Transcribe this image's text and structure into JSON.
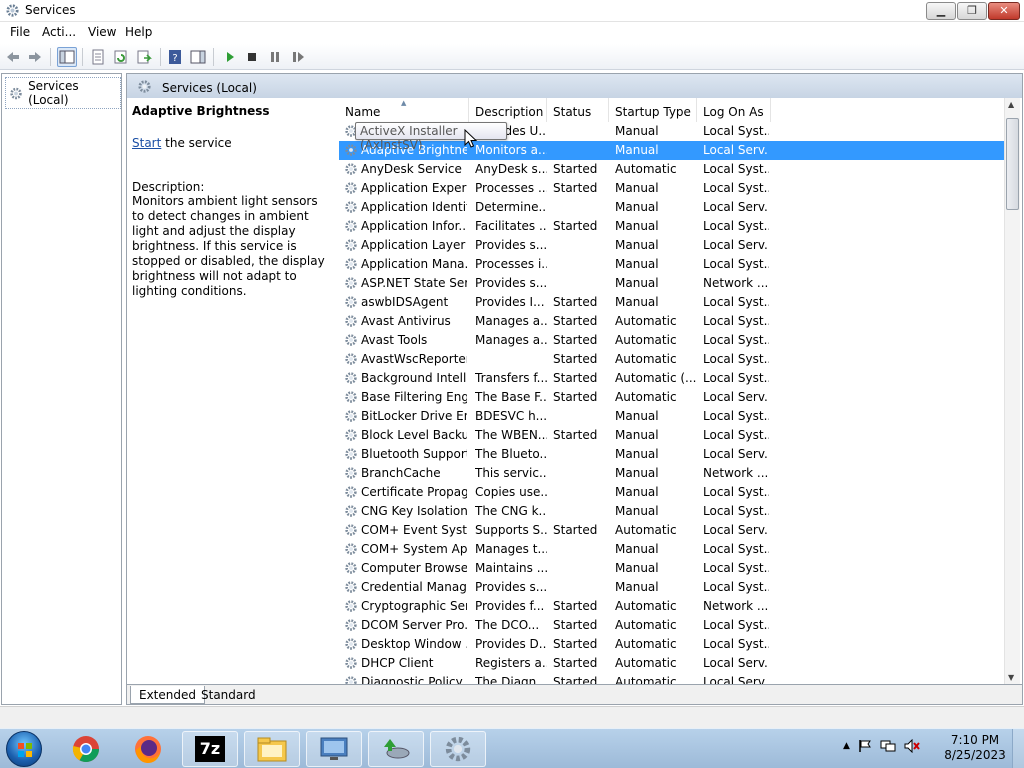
{
  "window": {
    "title": "Services",
    "buttons": {
      "minimize": "▁",
      "maximize": "❐",
      "close": "✕"
    }
  },
  "menu": [
    "File",
    "Acti...",
    "View",
    "Help"
  ],
  "toolbar": {
    "icons": [
      "back-icon",
      "forward-icon",
      "show-hide-console-tree-icon",
      "properties-icon",
      "refresh-icon",
      "export-list-icon",
      "help-icon",
      "show-action-pane-icon",
      "start-service-icon",
      "stop-service-icon",
      "pause-service-icon",
      "restart-service-icon"
    ]
  },
  "tree": {
    "root_label": "Services (Local)"
  },
  "main": {
    "header_title": "Services (Local)",
    "selected_service": "Adaptive Brightness",
    "start_link": "Start",
    "start_suffix": " the service",
    "description_label": "Description:",
    "description_text": "Monitors ambient light sensors to detect changes in ambient light and adjust the display brightness.  If this service is stopped or disabled, the display brightness will not adapt to lighting conditions."
  },
  "columns": [
    "Name",
    "Description",
    "Status",
    "Startup Type",
    "Log On As"
  ],
  "tooltip": "ActiveX Installer (AxInstSV)",
  "rows": [
    {
      "name": "ActiveX Installer (AxInstSV)",
      "description": "Provides U...",
      "status": "",
      "startup": "Manual",
      "logon": "Local Syst..."
    },
    {
      "name": "Adaptive Brightness",
      "description": "Monitors a...",
      "status": "",
      "startup": "Manual",
      "logon": "Local Serv..."
    },
    {
      "name": "AnyDesk Service",
      "description": "AnyDesk s...",
      "status": "Started",
      "startup": "Automatic",
      "logon": "Local Syst..."
    },
    {
      "name": "Application Experi...",
      "description": "Processes ...",
      "status": "Started",
      "startup": "Manual",
      "logon": "Local Syst..."
    },
    {
      "name": "Application Identity",
      "description": "Determine...",
      "status": "",
      "startup": "Manual",
      "logon": "Local Serv..."
    },
    {
      "name": "Application Infor...",
      "description": "Facilitates ...",
      "status": "Started",
      "startup": "Manual",
      "logon": "Local Syst..."
    },
    {
      "name": "Application Layer ...",
      "description": "Provides s...",
      "status": "",
      "startup": "Manual",
      "logon": "Local Serv..."
    },
    {
      "name": "Application Mana...",
      "description": "Processes i...",
      "status": "",
      "startup": "Manual",
      "logon": "Local Syst..."
    },
    {
      "name": "ASP.NET State Ser...",
      "description": "Provides s...",
      "status": "",
      "startup": "Manual",
      "logon": "Network ..."
    },
    {
      "name": "aswbIDSAgent",
      "description": "Provides I...",
      "status": "Started",
      "startup": "Manual",
      "logon": "Local Syst..."
    },
    {
      "name": "Avast Antivirus",
      "description": "Manages a...",
      "status": "Started",
      "startup": "Automatic",
      "logon": "Local Syst..."
    },
    {
      "name": "Avast Tools",
      "description": "Manages a...",
      "status": "Started",
      "startup": "Automatic",
      "logon": "Local Syst..."
    },
    {
      "name": "AvastWscReporter",
      "description": "",
      "status": "Started",
      "startup": "Automatic",
      "logon": "Local Syst..."
    },
    {
      "name": "Background Intelli...",
      "description": "Transfers f...",
      "status": "Started",
      "startup": "Automatic (...",
      "logon": "Local Syst..."
    },
    {
      "name": "Base Filtering Engi...",
      "description": "The Base F...",
      "status": "Started",
      "startup": "Automatic",
      "logon": "Local Serv..."
    },
    {
      "name": "BitLocker Drive En...",
      "description": "BDESVC h...",
      "status": "",
      "startup": "Manual",
      "logon": "Local Syst..."
    },
    {
      "name": "Block Level Backu...",
      "description": "The WBEN...",
      "status": "Started",
      "startup": "Manual",
      "logon": "Local Syst..."
    },
    {
      "name": "Bluetooth Support...",
      "description": "The Blueto...",
      "status": "",
      "startup": "Manual",
      "logon": "Local Serv..."
    },
    {
      "name": "BranchCache",
      "description": "This servic...",
      "status": "",
      "startup": "Manual",
      "logon": "Network ..."
    },
    {
      "name": "Certificate Propag...",
      "description": "Copies use...",
      "status": "",
      "startup": "Manual",
      "logon": "Local Syst..."
    },
    {
      "name": "CNG Key Isolation",
      "description": "The CNG k...",
      "status": "",
      "startup": "Manual",
      "logon": "Local Syst..."
    },
    {
      "name": "COM+ Event Syst...",
      "description": "Supports S...",
      "status": "Started",
      "startup": "Automatic",
      "logon": "Local Serv..."
    },
    {
      "name": "COM+ System Ap...",
      "description": "Manages t...",
      "status": "",
      "startup": "Manual",
      "logon": "Local Syst..."
    },
    {
      "name": "Computer Browser",
      "description": "Maintains ...",
      "status": "",
      "startup": "Manual",
      "logon": "Local Syst..."
    },
    {
      "name": "Credential Manager",
      "description": "Provides s...",
      "status": "",
      "startup": "Manual",
      "logon": "Local Syst..."
    },
    {
      "name": "Cryptographic Ser...",
      "description": "Provides f...",
      "status": "Started",
      "startup": "Automatic",
      "logon": "Network ..."
    },
    {
      "name": "DCOM Server Pro...",
      "description": "The DCO...",
      "status": "Started",
      "startup": "Automatic",
      "logon": "Local Syst..."
    },
    {
      "name": "Desktop Window ...",
      "description": "Provides D...",
      "status": "Started",
      "startup": "Automatic",
      "logon": "Local Syst..."
    },
    {
      "name": "DHCP Client",
      "description": "Registers a...",
      "status": "Started",
      "startup": "Automatic",
      "logon": "Local Serv..."
    },
    {
      "name": "Diagnostic Policy ...",
      "description": "The Diagn...",
      "status": "Started",
      "startup": "Automatic",
      "logon": "Local Serv..."
    }
  ],
  "tabs": [
    "Extended",
    "Standard"
  ],
  "taskbar": {
    "apps": [
      "chrome-icon",
      "firefox-icon",
      "7zip-icon",
      "file-explorer-icon",
      "remote-desktop-icon",
      "installer-icon",
      "services-icon"
    ],
    "labels": {
      "7zip": "7z"
    }
  },
  "clock": {
    "time": "7:10 PM",
    "date": "8/25/2023"
  }
}
